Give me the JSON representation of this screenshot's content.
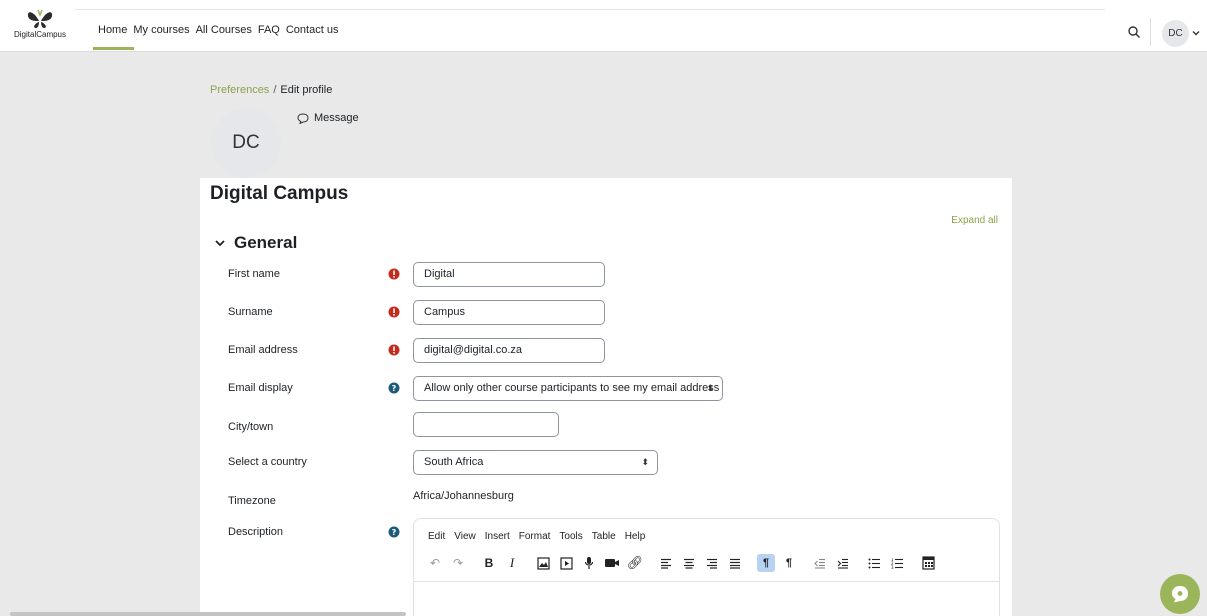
{
  "brand": {
    "logo_text": "DigitalCampus",
    "accent": "#9bb65a",
    "link_color": "#8aa34d",
    "required_color": "#c42b1c",
    "help_color": "#1f5a7a"
  },
  "nav": {
    "links": [
      "Home",
      "My courses",
      "All Courses",
      "FAQ",
      "Contact us"
    ],
    "active": "Home",
    "user_initials": "DC"
  },
  "breadcrumb": {
    "parent": "Preferences",
    "separator": "/",
    "current": "Edit profile"
  },
  "profile": {
    "initials": "DC",
    "message_label": "Message"
  },
  "page_title": "Digital Campus",
  "expand_all": "Expand all",
  "section": {
    "title": "General"
  },
  "fields": {
    "first_name": {
      "label": "First name",
      "value": "Digital"
    },
    "surname": {
      "label": "Surname",
      "value": "Campus"
    },
    "email": {
      "label": "Email address",
      "value": "digital@digital.co.za"
    },
    "email_display": {
      "label": "Email display",
      "value": "Allow only other course participants to see my email address"
    },
    "city": {
      "label": "City/town",
      "value": ""
    },
    "country": {
      "label": "Select a country",
      "value": "South Africa"
    },
    "timezone": {
      "label": "Timezone",
      "value": "Africa/Johannesburg"
    },
    "description": {
      "label": "Description"
    }
  },
  "editor": {
    "menus": [
      "Edit",
      "View",
      "Insert",
      "Format",
      "Tools",
      "Table",
      "Help"
    ],
    "tools": [
      "undo-icon",
      "redo-icon",
      "bold-icon",
      "italic-icon",
      "image-icon",
      "media-icon",
      "record-audio-icon",
      "record-video-icon",
      "link-icon",
      "align-left-icon",
      "align-center-icon",
      "align-right-icon",
      "justify-icon",
      "ltr-icon",
      "rtl-icon",
      "outdent-icon",
      "indent-icon",
      "bullet-list-icon",
      "numbered-list-icon",
      "equation-icon"
    ]
  }
}
